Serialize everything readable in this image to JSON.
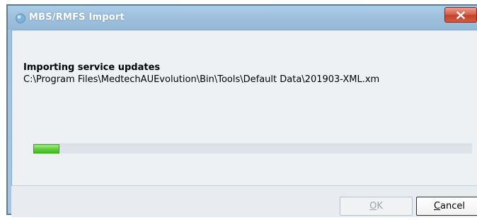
{
  "window": {
    "title": "MBS/RMFS Import",
    "close_icon": "close-icon",
    "app_icon": "app-icon"
  },
  "content": {
    "heading": "Importing service updates",
    "path": "C:\\Program Files\\MedtechAUEvolution\\Bin\\Tools\\Default Data\\201903-XML.xm"
  },
  "progress": {
    "value_fraction": 0.06,
    "fill_color": "#5fd13a"
  },
  "buttons": {
    "ok": {
      "mnemonic": "O",
      "rest": "K",
      "enabled": false
    },
    "cancel": {
      "mnemonic": "C",
      "rest": "ancel",
      "enabled": true
    }
  },
  "colors": {
    "titlebar": "#9dbfdc",
    "close_button": "#d35c42",
    "dialog_background": "#edf1f4"
  }
}
